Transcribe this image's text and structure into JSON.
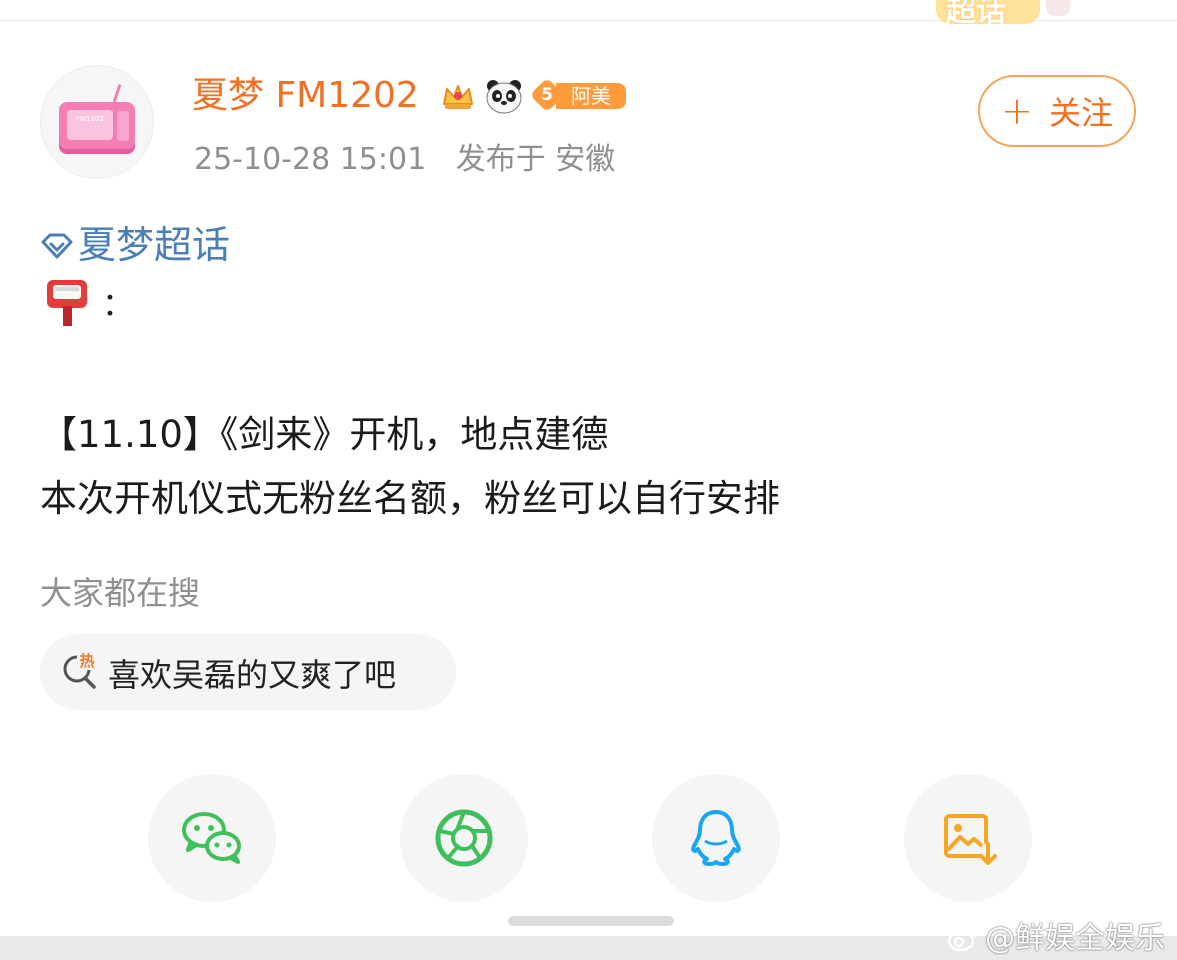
{
  "top_tab": {
    "label": "超话"
  },
  "user": {
    "username": "夏梦 FM1202",
    "avatar_label": "FM1202",
    "fan_badge_level": "5",
    "fan_badge_name": "阿美",
    "timestamp": "25-10-28 15:01",
    "location": "发布于 安徽"
  },
  "follow_button": {
    "label": "关注",
    "icon": "plus-icon"
  },
  "post": {
    "super_topic": "夏梦超话",
    "mailbox_icon": "postbox-emoji",
    "mailbox_suffix": "：",
    "lines": [
      "【11.10】《剑来》开机，地点建德",
      "本次开机仪式无粉丝名额，粉丝可以自行安排"
    ]
  },
  "search_section": {
    "title": "大家都在搜",
    "hot_icon_label": "热",
    "items": [
      "喜欢吴磊的又爽了吧"
    ]
  },
  "share_bar": {
    "icons": [
      "wechat-icon",
      "moments-icon",
      "qq-icon",
      "save-image-icon"
    ]
  },
  "watermark": {
    "text": "@鲜娱全娱乐"
  },
  "colors": {
    "brand_orange": "#f27022",
    "link_blue": "#4a7fb5",
    "wechat_green": "#3fc05a",
    "qq_blue": "#17a6ef",
    "save_orange": "#f6a623"
  }
}
